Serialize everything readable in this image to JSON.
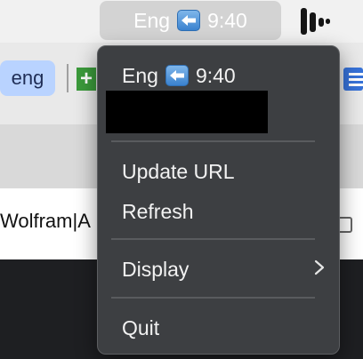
{
  "menubar": {
    "language": "Eng",
    "time": "9:40"
  },
  "background": {
    "tab_label": "eng",
    "content_text": "Wolfram|A"
  },
  "menu": {
    "header_language": "Eng",
    "header_time": "9:40",
    "items": [
      {
        "label": "Update URL"
      },
      {
        "label": "Refresh"
      },
      {
        "label": "Display"
      },
      {
        "label": "Quit"
      }
    ]
  },
  "colors": {
    "menu_bg": "#3d3f42",
    "menubar_bg": "#f1f1f1",
    "accent_badge": "#3a82cf"
  }
}
